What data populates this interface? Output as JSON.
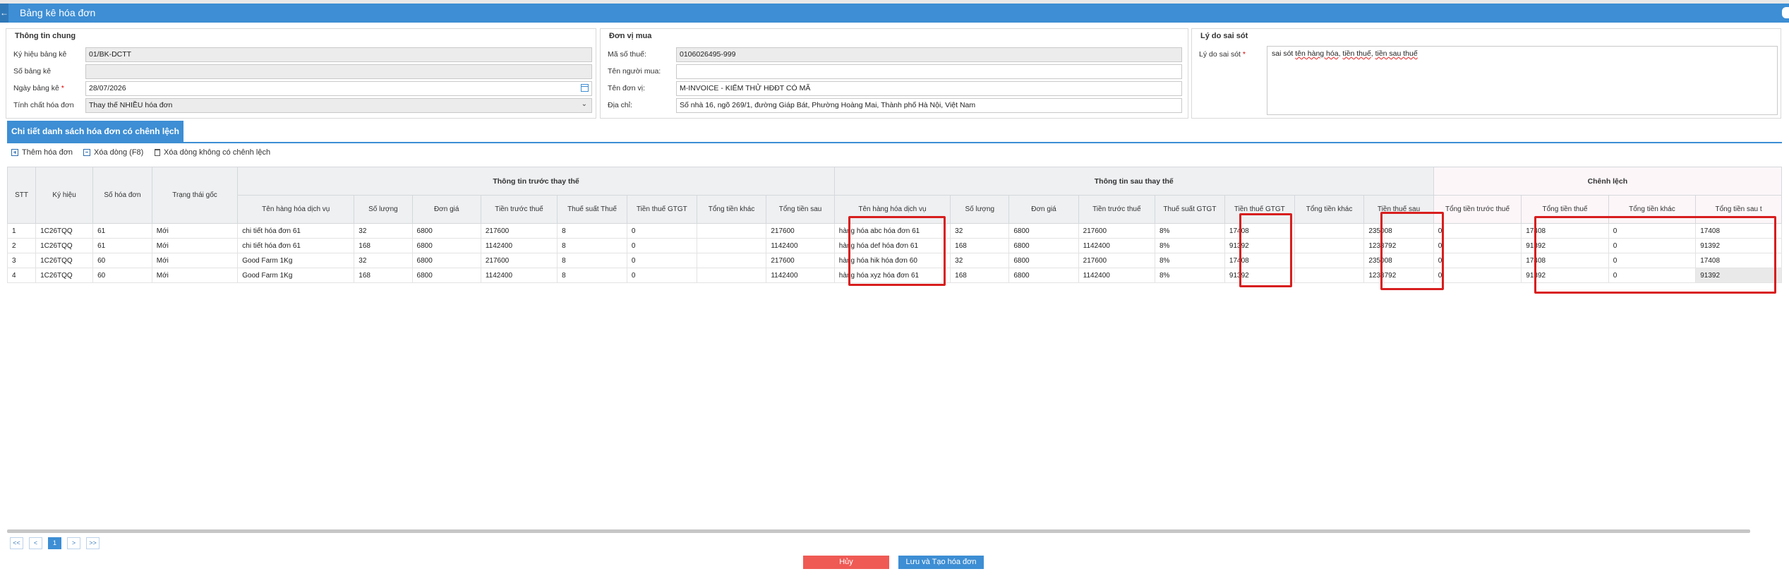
{
  "header": {
    "title": "Bảng kê hóa đơn"
  },
  "general_info": {
    "title": "Thông tin chung",
    "symbol_label": "Ký hiệu bảng kê",
    "symbol_value": "01/BK-DCTT",
    "number_label": "Số bảng kê",
    "number_value": "",
    "date_label": "Ngày bảng kê",
    "date_value": "28/07/2026",
    "nature_label": "Tính chất hóa đơn",
    "nature_value": "Thay thế NHIỀU hóa đơn"
  },
  "buyer": {
    "title": "Đơn vị mua",
    "tax_label": "Mã số thuế:",
    "tax_value": "0106026495-999",
    "buyer_name_label": "Tên người mua:",
    "buyer_name_value": "",
    "unit_label": "Tên đơn vị:",
    "unit_value": "M-INVOICE - KIỂM THỬ HĐĐT CÓ MÃ",
    "address_label": "Địa chỉ:",
    "address_value": "Số nhà 16, ngõ 269/1, đường Giáp Bát, Phường Hoàng Mai, Thành phố Hà Nội, Việt Nam"
  },
  "reason": {
    "title": "Lý do sai sót",
    "label": "Lý do sai sót",
    "value_prefix": "sai sót ",
    "value_spell1": "tên hàng hóa",
    "value_mid": ", ",
    "value_spell2": "tiền thuế",
    "value_mid2": ", ",
    "value_spell3": "tiền sau thuế"
  },
  "tab": {
    "label": "Chi tiết danh sách hóa đơn có chênh lệch"
  },
  "toolbar": {
    "add": "Thêm hóa đơn",
    "delete": "Xóa dòng (F8)",
    "delete_nodiff": "Xóa dòng không có chênh lệch"
  },
  "grid": {
    "groups": {
      "before": "Thông tin trước thay thế",
      "after": "Thông tin sau thay thế",
      "diff": "Chênh lệch"
    },
    "fixed_headers": [
      "STT",
      "Ký hiệu",
      "Số hóa đơn",
      "Trạng thái gốc"
    ],
    "before_headers": [
      "Tên hàng hóa dịch vụ",
      "Số lượng",
      "Đơn giá",
      "Tiền trước thuế",
      "Thuế suất Thuế",
      "Tiền thuế GTGT",
      "Tổng tiền khác",
      "Tổng tiền sau"
    ],
    "after_headers": [
      "Tên hàng hóa dịch vụ",
      "Số lượng",
      "Đơn giá",
      "Tiền trước thuế",
      "Thuế suất GTGT",
      "Tiền thuế GTGT",
      "Tổng tiền khác",
      "Tiền thuế sau"
    ],
    "diff_headers": [
      "Tổng tiền trước thuế",
      "Tổng tiền thuế",
      "Tổng tiền khác",
      "Tổng tiền sau t"
    ],
    "rows": [
      [
        "1",
        "1C26TQQ",
        "61",
        "Mới",
        "chi tiết hóa đơn 61",
        "32",
        "6800",
        "217600",
        "8",
        "0",
        "",
        "217600",
        "hàng hóa abc hóa đơn 61",
        "32",
        "6800",
        "217600",
        "8%",
        "17408",
        "",
        "235008",
        "0",
        "17408",
        "0",
        "17408"
      ],
      [
        "2",
        "1C26TQQ",
        "61",
        "Mới",
        "chi tiết hóa đơn 61",
        "168",
        "6800",
        "1142400",
        "8",
        "0",
        "",
        "1142400",
        "hàng hóa def hóa đơn 61",
        "168",
        "6800",
        "1142400",
        "8%",
        "91392",
        "",
        "1233792",
        "0",
        "91392",
        "0",
        "91392"
      ],
      [
        "3",
        "1C26TQQ",
        "60",
        "Mới",
        "Good Farm 1Kg",
        "32",
        "6800",
        "217600",
        "8",
        "0",
        "",
        "217600",
        "hàng hóa hik hóa đơn 60",
        "32",
        "6800",
        "217600",
        "8%",
        "17408",
        "",
        "235008",
        "0",
        "17408",
        "0",
        "17408"
      ],
      [
        "4",
        "1C26TQQ",
        "60",
        "Mới",
        "Good Farm 1Kg",
        "168",
        "6800",
        "1142400",
        "8",
        "0",
        "",
        "1142400",
        "hàng hóa xyz hóa đơn 61",
        "168",
        "6800",
        "1142400",
        "8%",
        "91392",
        "",
        "1233792",
        "0",
        "91392",
        "0",
        "91392"
      ]
    ]
  },
  "pager": {
    "first": "<<",
    "prev": "<",
    "page": "1",
    "next": ">",
    "last": ">>"
  },
  "actions": {
    "cancel": "Hủy",
    "save": "Lưu và Tạo hóa đơn"
  },
  "colors": {
    "primary": "#3d8ed4",
    "danger": "#ef5a55",
    "highlight": "#d81e1e"
  }
}
